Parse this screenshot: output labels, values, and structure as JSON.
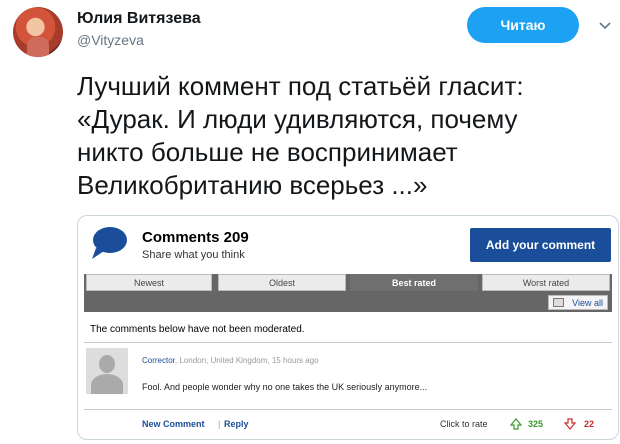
{
  "tweet": {
    "user_name": "Юлия Витязева",
    "handle": "@Vityzeva",
    "follow_label": "Читаю",
    "text": "Лучший коммент под статьёй гласит:\n«Дурак. И люди удивляются, почему\nникто больше не воспринимает\nВеликобританию всерьез ...»"
  },
  "embed": {
    "title": "Comments 209",
    "subtitle": "Share what you think",
    "add_button": "Add your comment",
    "tabs": [
      {
        "label": "Newest",
        "active": false
      },
      {
        "label": "Oldest",
        "active": false
      },
      {
        "label": "Best rated",
        "active": true
      },
      {
        "label": "Worst rated",
        "active": false
      }
    ],
    "view_all": "View all",
    "notice": "The comments below have not been moderated.",
    "comment": {
      "author": "Corrector",
      "meta": ", London, United Kingdom, 15 hours ago",
      "body": "Fool. And people wonder why no one takes the UK seriously anymore...",
      "new_comment": "New Comment",
      "reply": "Reply",
      "separator": "|",
      "click_to_rate": "Click to rate",
      "up_votes": "325",
      "down_votes": "22"
    }
  },
  "colors": {
    "twitter_blue": "#1da1f2",
    "dm_blue": "#1a4e9a",
    "upvote_green": "#3a9a2a",
    "downvote_red": "#cc2a2a"
  }
}
